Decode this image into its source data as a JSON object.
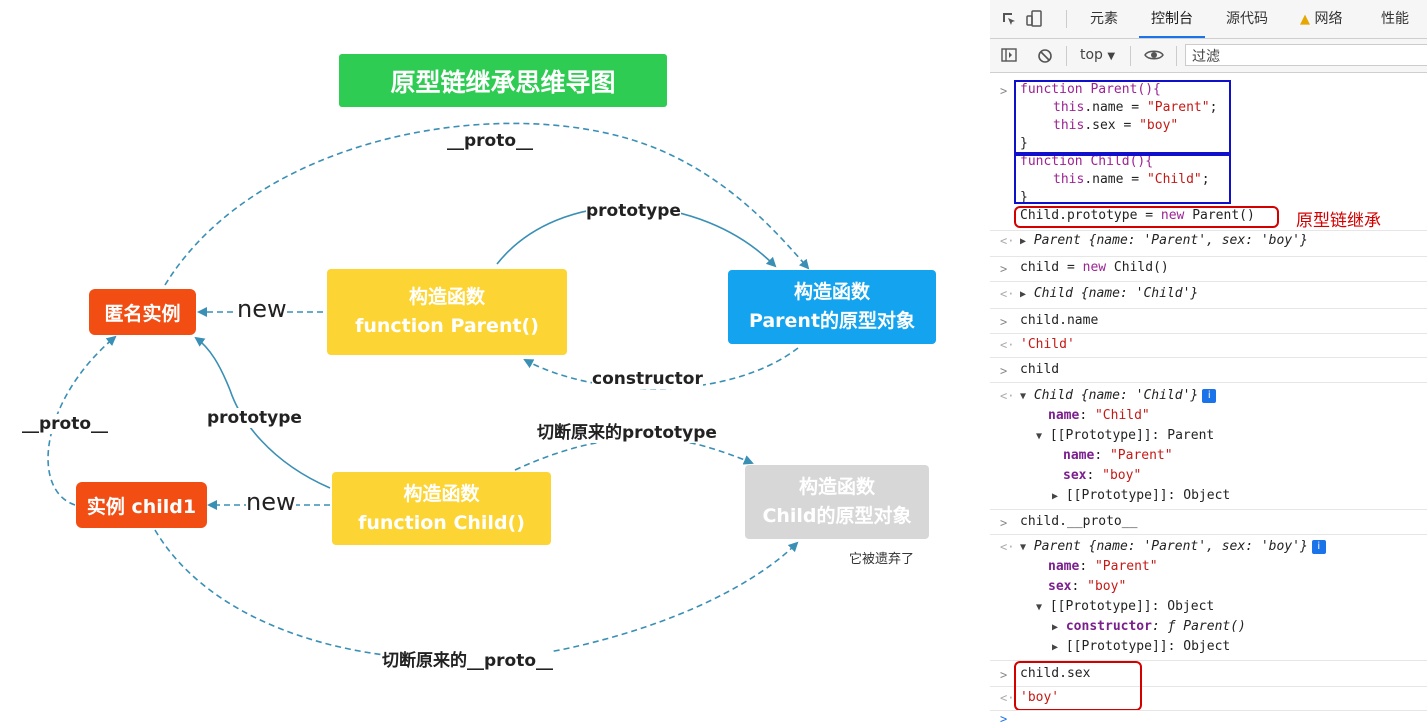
{
  "diagram": {
    "title": "原型链继承思维导图",
    "parent_ctor": {
      "line1": "构造函数",
      "line2": "function Parent()"
    },
    "parent_proto": {
      "line1": "构造函数",
      "line2": "Parent的原型对象"
    },
    "child_ctor": {
      "line1": "构造函数",
      "line2": "function Child()"
    },
    "child_proto": {
      "line1": "构造函数",
      "line2": "Child的原型对象"
    },
    "anon_instance": "匿名实例",
    "child_instance": "实例 child1",
    "labels": {
      "proto_top": "__proto__",
      "prototype_top": "prototype",
      "constructor": "constructor",
      "new1": "new",
      "new2": "new",
      "proto_left": "__proto__",
      "prototype_mid": "prototype",
      "cut_prototype": "切断原来的prototype",
      "cut_proto": "切断原来的__proto__",
      "abandoned": "它被遗弃了"
    },
    "colors": {
      "title": "#2ecc52",
      "ctor": "#fcd535",
      "proto": "#14a3ee",
      "instance": "#f24d13",
      "abandoned": "#d7d7d7",
      "arrow": "#3a8fb5"
    }
  },
  "devtools": {
    "tabs": [
      "元素",
      "控制台",
      "源代码",
      "网络",
      "性能"
    ],
    "active_tab": "控制台",
    "warning_icon": "warning-icon",
    "context": "top",
    "filter_placeholder": "过滤",
    "annotation": "原型链继承",
    "code": {
      "l1": "function Parent(){",
      "l2a": "this",
      "l2b": ".name = ",
      "l2c": "\"Parent\"",
      "l2d": ";",
      "l3a": "this",
      "l3b": ".sex = ",
      "l3c": "\"boy\"",
      "l4": "}",
      "l5": "function Child(){",
      "l6a": "this",
      "l6b": ".name = ",
      "l6c": "\"Child\"",
      "l6d": ";",
      "l7": "}",
      "l8a": "Child.prototype = ",
      "l8b": "new",
      "l8c": " Parent()"
    },
    "out1": {
      "name": "Parent",
      "body": " {name: 'Parent', sex: 'boy'}"
    },
    "in2a": "child = ",
    "in2b": "new",
    "in2c": " Child()",
    "out2": {
      "name": "Child",
      "body": " {name: 'Child'}"
    },
    "in3": "child.name",
    "out3": "'Child'",
    "in4": "child",
    "out4": {
      "head_name": "Child",
      "head_body": " {name: 'Child'}",
      "k_name": "name",
      "v_name": "\"Child\"",
      "proto_key": "[[Prototype]]",
      "proto_val": ": Parent",
      "k_name2": "name",
      "v_name2": "\"Parent\"",
      "k_sex": "sex",
      "v_sex": "\"boy\"",
      "proto2_key": "[[Prototype]]",
      "proto2_val": ": Object"
    },
    "in5": "child.__proto__",
    "out5": {
      "head_name": "Parent",
      "head_body": " {name: 'Parent', sex: 'boy'}",
      "k_name": "name",
      "v_name": "\"Parent\"",
      "k_sex": "sex",
      "v_sex": "\"boy\"",
      "proto_key": "[[Prototype]]",
      "proto_val": ": Object",
      "ctor_key": "constructor",
      "ctor_val": ": ƒ Parent()",
      "proto2_key": "[[Prototype]]",
      "proto2_val": ": Object"
    },
    "in6": "child.sex",
    "out6": "'boy'"
  }
}
